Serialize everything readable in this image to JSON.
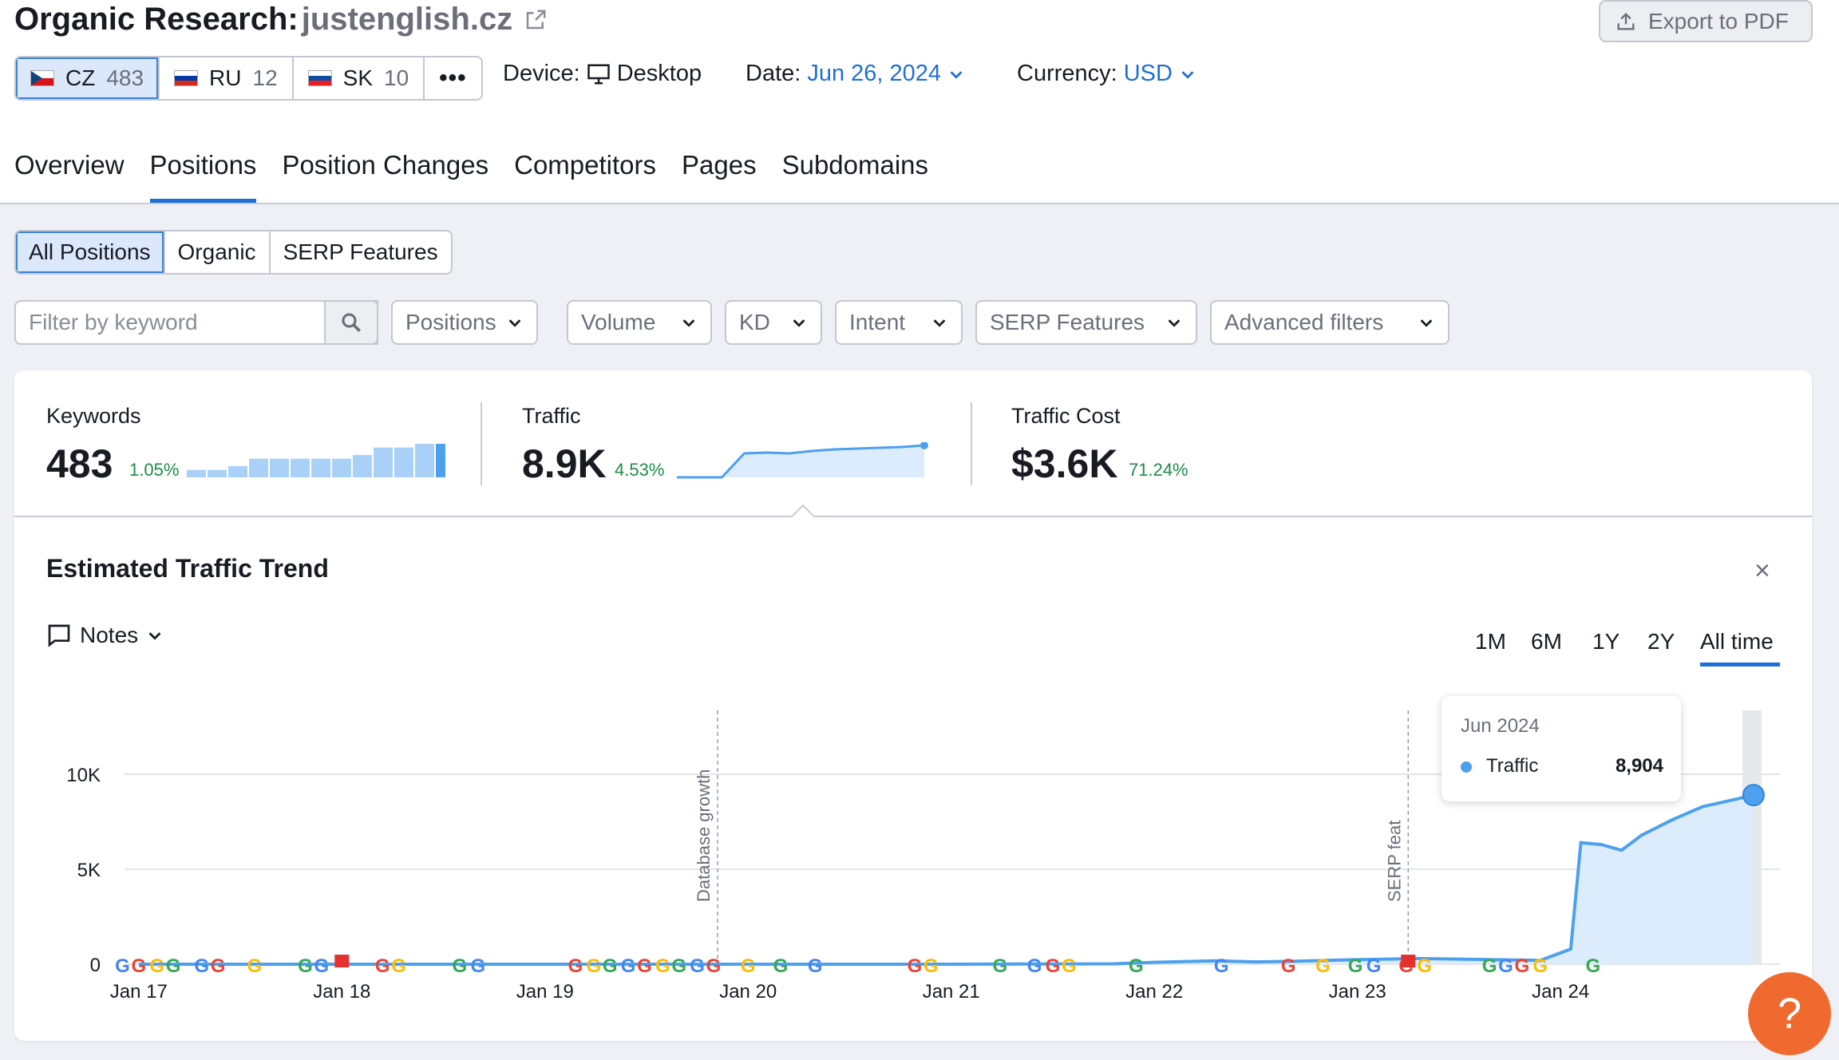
{
  "header": {
    "title": "Organic Research:",
    "domain": "justenglish.cz",
    "export_label": "Export to PDF"
  },
  "databases": [
    {
      "code": "CZ",
      "count": "483",
      "active": true
    },
    {
      "code": "RU",
      "count": "12",
      "active": false
    },
    {
      "code": "SK",
      "count": "10",
      "active": false
    }
  ],
  "more_label": "•••",
  "device": {
    "label": "Device:",
    "value": "Desktop"
  },
  "date": {
    "label": "Date:",
    "value": "Jun 26, 2024"
  },
  "currency": {
    "label": "Currency:",
    "value": "USD"
  },
  "nav_tabs": [
    "Overview",
    "Positions",
    "Position Changes",
    "Competitors",
    "Pages",
    "Subdomains"
  ],
  "position_tabs": [
    "All Positions",
    "Organic",
    "SERP Features"
  ],
  "filters": {
    "keyword_placeholder": "Filter by keyword",
    "dropdowns": [
      "Positions",
      "Volume",
      "KD",
      "Intent",
      "SERP Features",
      "Advanced filters"
    ]
  },
  "kpis": {
    "keywords": {
      "label": "Keywords",
      "value": "483",
      "change": "1.05%",
      "bars": [
        2,
        2,
        3,
        5,
        5,
        5,
        5,
        5,
        6,
        8,
        8,
        9,
        9
      ]
    },
    "traffic": {
      "label": "Traffic",
      "value": "8.9K",
      "change": "4.53%",
      "spark": [
        0,
        0,
        0,
        60,
        62,
        60,
        66,
        70,
        72,
        74,
        76,
        80
      ]
    },
    "traffic_cost": {
      "label": "Traffic Cost",
      "value": "$3.6K",
      "change": "71.24%"
    }
  },
  "trend": {
    "title": "Estimated Traffic Trend",
    "close_label": "×",
    "notes_label": "Notes",
    "ranges": [
      "1M",
      "6M",
      "1Y",
      "2Y",
      "All time"
    ],
    "active_range": "All time",
    "tooltip": {
      "month": "Jun 2024",
      "series": "Traffic",
      "value": "8,904"
    }
  },
  "colors": {
    "accent": "#1d6fd6",
    "line": "#4da0ee",
    "area": "#dcecfc",
    "positive": "#1f8a4c",
    "help": "#f06a2f"
  },
  "chart_data": {
    "type": "area",
    "series": [
      {
        "name": "Traffic",
        "points": [
          [
            2017.0,
            0
          ],
          [
            2018.0,
            0
          ],
          [
            2019.0,
            0
          ],
          [
            2020.0,
            0
          ],
          [
            2021.0,
            0
          ],
          [
            2021.8,
            20
          ],
          [
            2022.0,
            100
          ],
          [
            2022.3,
            180
          ],
          [
            2022.5,
            120
          ],
          [
            2022.7,
            160
          ],
          [
            2023.0,
            240
          ],
          [
            2023.3,
            300
          ],
          [
            2023.6,
            250
          ],
          [
            2023.9,
            200
          ],
          [
            2024.05,
            800
          ],
          [
            2024.1,
            6400
          ],
          [
            2024.2,
            6300
          ],
          [
            2024.3,
            6000
          ],
          [
            2024.4,
            6800
          ],
          [
            2024.55,
            7600
          ],
          [
            2024.7,
            8300
          ],
          [
            2024.85,
            8650
          ],
          [
            2024.95,
            8904
          ]
        ]
      }
    ],
    "x_ticks": [
      "Jan 17",
      "Jan 18",
      "Jan 19",
      "Jan 20",
      "Jan 21",
      "Jan 22",
      "Jan 23",
      "Jan 24"
    ],
    "x_tick_values": [
      2017,
      2018,
      2019,
      2020,
      2021,
      2022,
      2023,
      2024
    ],
    "xlim": [
      2016.93,
      2025.08
    ],
    "y_ticks": [
      "0",
      "5K",
      "10K"
    ],
    "y_tick_values": [
      0,
      5000,
      10000
    ],
    "ylim": [
      0,
      10000
    ],
    "annotations": [
      {
        "label": "Database growth",
        "x": 2019.85
      },
      {
        "label": "SERP feat",
        "x": 2023.25
      }
    ],
    "note_flags": [
      2018.0,
      2023.25
    ],
    "google_markers": [
      2016.92,
      2017.0,
      2017.09,
      2017.17,
      2017.31,
      2017.39,
      2017.57,
      2017.82,
      2017.9,
      2018.2,
      2018.28,
      2018.58,
      2018.67,
      2019.15,
      2019.24,
      2019.32,
      2019.41,
      2019.49,
      2019.58,
      2019.66,
      2019.75,
      2019.83,
      2020.0,
      2020.16,
      2020.33,
      2020.82,
      2020.9,
      2021.24,
      2021.41,
      2021.5,
      2021.58,
      2021.91,
      2022.33,
      2022.66,
      2022.83,
      2022.99,
      2023.08,
      2023.24,
      2023.33,
      2023.65,
      2023.73,
      2023.81,
      2023.9,
      2024.16
    ],
    "grid": true
  }
}
